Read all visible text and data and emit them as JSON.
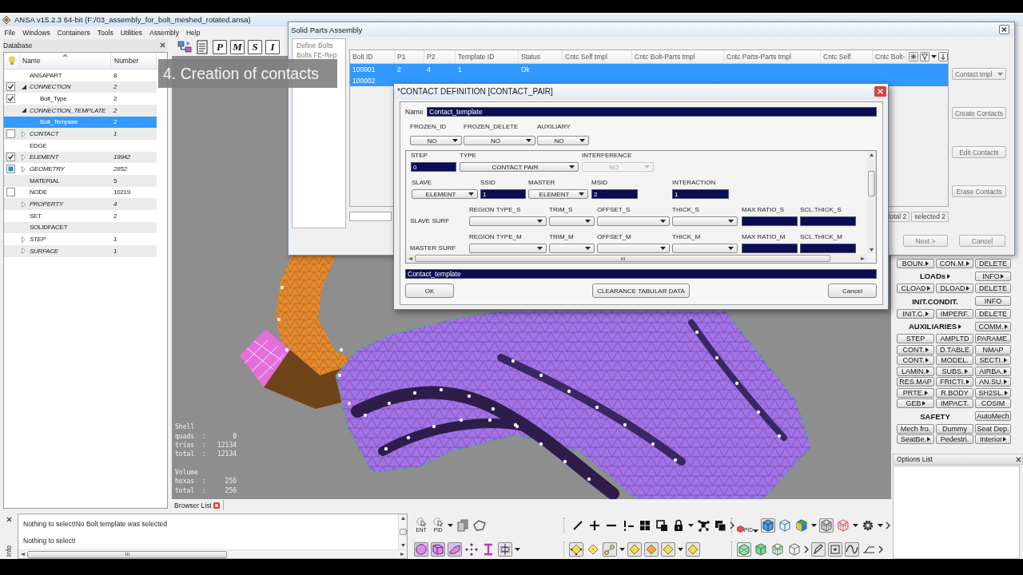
{
  "app_window": {
    "title": "ANSA v15.2.3 64-bit (F:/03_assembly_for_bolt_meshed_rotated.ansa)",
    "menu": [
      "File",
      "Windows",
      "Containers",
      "Tools",
      "Utilities",
      "Assembly",
      "Help"
    ]
  },
  "database": {
    "title": "Database",
    "columns": [
      "Name",
      "Number"
    ],
    "items": [
      {
        "name": "ANSAPART",
        "number": "8",
        "selected": false
      },
      {
        "name": "CONNECTION",
        "number": "2",
        "checked": true,
        "partial": false,
        "expanded": true,
        "selected": false,
        "children": [
          {
            "name": "Bolt_Type",
            "number": "2",
            "checked": true,
            "partial": false,
            "selected": false
          }
        ]
      },
      {
        "name": "CONNECTION_TEMPLATE",
        "number": "2",
        "expanded": true,
        "selected": false,
        "children": [
          {
            "name": "Bolt_Template",
            "number": "2",
            "selected": true
          }
        ]
      },
      {
        "name": "CONTACT",
        "number": "1",
        "checked": false,
        "partial": false,
        "expanded": false,
        "selected": false
      },
      {
        "name": "EDGE",
        "selected": false
      },
      {
        "name": "ELEMENT",
        "number": "19942",
        "checked": true,
        "partial": false,
        "expanded": false,
        "selected": false
      },
      {
        "name": "GEOMETRY",
        "number": "2852",
        "checked": false,
        "partial": true,
        "expanded": false,
        "selected": false
      },
      {
        "name": "MATERIAL",
        "number": "5",
        "selected": false
      },
      {
        "name": "NODE",
        "number": "10219",
        "checked": false,
        "partial": false,
        "selected": false
      },
      {
        "name": "PROPERTY",
        "number": "4",
        "expanded": false,
        "selected": false
      },
      {
        "name": "SET",
        "number": "2",
        "selected": false
      },
      {
        "name": "SOLIDFACET",
        "selected": false
      },
      {
        "name": "STEP",
        "number": "1",
        "expanded": false,
        "selected": false
      },
      {
        "name": "SURFACE",
        "number": "1",
        "expanded": false,
        "selected": false
      }
    ]
  },
  "main_toolbar": {
    "letter_buttons": [
      "P",
      "M",
      "S",
      "I"
    ]
  },
  "caption": "4. Creation of contacts",
  "viewport": {
    "stats": [
      {
        "heading": "Shell",
        "lines": [
          "quads  :       0",
          "trias  :   12134",
          "total  :   12134"
        ]
      },
      {
        "heading": "Volume",
        "lines": [
          "hexas  :     256",
          "total  :     256"
        ]
      }
    ]
  },
  "browser_list": {
    "tab": "Browser List"
  },
  "messages": {
    "side_label": "Info",
    "lines": [
      "Nothing to select!No Bolt template was selected",
      "Nothing to select!"
    ]
  },
  "bottom_toolbar": {
    "pick_labels": [
      "ENT",
      "PID"
    ],
    "filter_label": "PID"
  },
  "deck_panel": {
    "rows": [
      {
        "cells": [
          {
            "kind": "button",
            "label": "BOUN.",
            "submenu": true
          },
          {
            "kind": "button",
            "label": "CON.M.",
            "submenu": true
          },
          {
            "kind": "button",
            "label": "DELETE",
            "submenu": false
          }
        ]
      },
      {
        "cells": [
          {
            "kind": "heading",
            "label": "LOADs",
            "submenu": true
          },
          {
            "kind": "button",
            "label": "INFO",
            "submenu": true
          }
        ]
      },
      {
        "cells": [
          {
            "kind": "button",
            "label": "CLOAD",
            "submenu": true
          },
          {
            "kind": "button",
            "label": "DLOAD",
            "submenu": true
          },
          {
            "kind": "button",
            "label": "DELETE",
            "submenu": false
          }
        ]
      },
      {
        "cells": [
          {
            "kind": "heading",
            "label": "INIT.CONDIT.",
            "submenu": false
          },
          {
            "kind": "button",
            "label": "INFO",
            "submenu": false
          }
        ]
      },
      {
        "cells": [
          {
            "kind": "button",
            "label": "INIT.C.",
            "submenu": true
          },
          {
            "kind": "button",
            "label": "IMPERF.",
            "submenu": false
          },
          {
            "kind": "button",
            "label": "DELETE",
            "submenu": false
          }
        ]
      },
      {
        "cells": [
          {
            "kind": "heading",
            "label": "AUXILIARIES",
            "submenu": true
          },
          {
            "kind": "button",
            "label": "COMM.",
            "submenu": true
          }
        ]
      },
      {
        "cells": [
          {
            "kind": "button",
            "label": "STEP",
            "submenu": false
          },
          {
            "kind": "button",
            "label": "AMPLTD",
            "submenu": false
          },
          {
            "kind": "button",
            "label": "PARAME.",
            "submenu": false
          }
        ]
      },
      {
        "cells": [
          {
            "kind": "button",
            "label": "CONT.",
            "submenu": true
          },
          {
            "kind": "button",
            "label": "D.TABLE",
            "submenu": false
          },
          {
            "kind": "button",
            "label": "NMAP",
            "submenu": false
          }
        ]
      },
      {
        "cells": [
          {
            "kind": "button",
            "label": "CONT.",
            "submenu": true
          },
          {
            "kind": "button",
            "label": "MODEL.",
            "submenu": false
          },
          {
            "kind": "button",
            "label": "SECTI.",
            "submenu": true
          }
        ]
      },
      {
        "cells": [
          {
            "kind": "button",
            "label": "LAMIN.",
            "submenu": true
          },
          {
            "kind": "button",
            "label": "SUBS.",
            "submenu": true
          },
          {
            "kind": "button",
            "label": "AIRBA.",
            "submenu": true
          }
        ]
      },
      {
        "cells": [
          {
            "kind": "button",
            "label": "RES.MAP",
            "submenu": false
          },
          {
            "kind": "button",
            "label": "FRICTI.",
            "submenu": true
          },
          {
            "kind": "button",
            "label": "AN.SU.",
            "submenu": true
          }
        ]
      },
      {
        "cells": [
          {
            "kind": "button",
            "label": "PRTE.",
            "submenu": true
          },
          {
            "kind": "button",
            "label": "R.BODY",
            "submenu": false
          },
          {
            "kind": "button",
            "label": "SH2SL.",
            "submenu": true
          }
        ]
      },
      {
        "cells": [
          {
            "kind": "button",
            "label": "GEB",
            "submenu": true
          },
          {
            "kind": "button",
            "label": "IMPACT.",
            "submenu": false
          },
          {
            "kind": "button",
            "label": "COSIM",
            "submenu": false
          }
        ]
      },
      {
        "cells": [
          {
            "kind": "heading",
            "label": "SAFETY",
            "submenu": false
          },
          {
            "kind": "button",
            "label": "AutoMech",
            "submenu": false
          }
        ]
      },
      {
        "cells": [
          {
            "kind": "button",
            "label": "Mech fro.",
            "submenu": false
          },
          {
            "kind": "button",
            "label": "Dummy",
            "submenu": false
          },
          {
            "kind": "button",
            "label": "Seat Dep.",
            "submenu": false
          }
        ]
      },
      {
        "cells": [
          {
            "kind": "button",
            "label": "SeatBe.",
            "submenu": true
          },
          {
            "kind": "button",
            "label": "Pedestri.",
            "submenu": false
          },
          {
            "kind": "button",
            "label": "Interior",
            "submenu": true
          }
        ]
      }
    ]
  },
  "options_list": {
    "title": "Options List"
  },
  "solid_parts_assembly": {
    "title": "Solid Parts Assembly",
    "steps": [
      "Define Bolts",
      "Bolts FE-Rep"
    ],
    "table": {
      "columns": [
        "Bolt ID",
        "P1",
        "P2",
        "Template ID",
        "Status",
        "Cntc Self tmpl",
        "Cntc Bolt-Parts tmpl",
        "Cntc Parts-Parts tmpl",
        "Cntc Self",
        "Cntc Bolt-"
      ],
      "rows": [
        {
          "selected": true,
          "cells": [
            "100001",
            "2",
            "4",
            "1",
            "Ok"
          ]
        },
        {
          "selected": true,
          "cells": [
            "100002"
          ]
        }
      ]
    },
    "counts": [
      "total 2",
      "selected 2"
    ],
    "actions": [
      {
        "kind": "dropdown",
        "label": "Contact tmpl"
      },
      {
        "kind": "button",
        "label": "Create Contacts"
      },
      {
        "kind": "button",
        "label": "Edit Contacts"
      },
      {
        "kind": "button",
        "label": "Erase Contacts"
      }
    ],
    "nav_buttons": [
      "Next >",
      "Cancel"
    ]
  },
  "contact_dialog": {
    "title": "*CONTACT DEFINITION [CONTACT_PAIR]",
    "name_label": "Name",
    "name_value": "Contact_template",
    "options": [
      {
        "label": "FROZEN_ID",
        "kind": "dropdown",
        "value": "NO",
        "disabled": false
      },
      {
        "label": "FROZEN_DELETE",
        "kind": "dropdown",
        "value": "NO",
        "disabled": false
      },
      {
        "label": "AUXILIARY",
        "kind": "dropdown",
        "value": "NO",
        "disabled": false
      }
    ],
    "rows": [
      {
        "fields": [
          {
            "label": "STEP",
            "kind": "input",
            "value": "0",
            "disabled": false
          },
          {
            "label": "TYPE",
            "kind": "dropdown",
            "value": "CONTACT PAIR",
            "disabled": false
          },
          {
            "label": "INTERFERENCE",
            "kind": "dropdown",
            "value": "NO",
            "disabled": true
          }
        ]
      },
      {
        "fields": [
          {
            "label": "SLAVE",
            "kind": "dropdown",
            "value": "ELEMENT",
            "disabled": false
          },
          {
            "label": "SSID",
            "kind": "input",
            "value": "1",
            "disabled": false
          },
          {
            "label": "MASTER",
            "kind": "dropdown",
            "value": "ELEMENT",
            "disabled": false
          },
          {
            "label": "MSID",
            "kind": "input",
            "value": "2",
            "disabled": false
          },
          {
            "label": "INTERACTION",
            "kind": "input",
            "value": "1",
            "disabled": false
          }
        ]
      },
      {
        "row_label": "SLAVE SURF",
        "fields": [
          {
            "label": "REGION TYPE_S",
            "kind": "dropdown",
            "disabled": false
          },
          {
            "label": "TRIM_S",
            "kind": "dropdown",
            "disabled": false
          },
          {
            "label": "OFFSET_S",
            "kind": "dropdown",
            "disabled": false
          },
          {
            "label": "THICK_S",
            "kind": "dropdown",
            "disabled": false
          },
          {
            "label": "MAX RATIO_S",
            "kind": "input",
            "disabled": false
          },
          {
            "label": "SCL.THICK_S",
            "kind": "input",
            "disabled": false
          }
        ]
      },
      {
        "row_label": "MASTER SURF",
        "fields": [
          {
            "label": "REGION TYPE_M",
            "kind": "dropdown",
            "disabled": false
          },
          {
            "label": "TRIM_M",
            "kind": "dropdown",
            "disabled": false
          },
          {
            "label": "OFFSET_M",
            "kind": "dropdown",
            "disabled": false
          },
          {
            "label": "THICK_M",
            "kind": "dropdown",
            "disabled": false
          },
          {
            "label": "MAX RATIO_M",
            "kind": "input",
            "disabled": false
          },
          {
            "label": "SCL.THICK_M",
            "kind": "input",
            "disabled": false
          }
        ]
      }
    ],
    "status_value": "Contact_template",
    "buttons": [
      "OK",
      "CLEARANCE TABULAR DATA",
      "Cancel"
    ]
  }
}
